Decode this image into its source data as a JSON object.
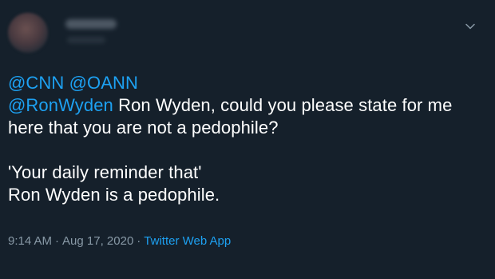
{
  "tweet": {
    "reply_to": [
      "@CNN",
      "@OANN"
    ],
    "mention": "@RonWyden",
    "text_line_1": " Ron Wyden, could you please state for me",
    "text_line_2": "here that you are not a pedophile?",
    "text_line_3": "'Your daily reminder that'",
    "text_line_4": "Ron Wyden is a pedophile.",
    "time": "9:14 AM",
    "separator": "·",
    "date": "Aug 17, 2020",
    "source": "Twitter Web App"
  },
  "icons": {
    "menu": "chevron-down-icon"
  },
  "colors": {
    "background": "#15202b",
    "text": "#ffffff",
    "link": "#1da1f2",
    "muted": "#8899a6"
  }
}
